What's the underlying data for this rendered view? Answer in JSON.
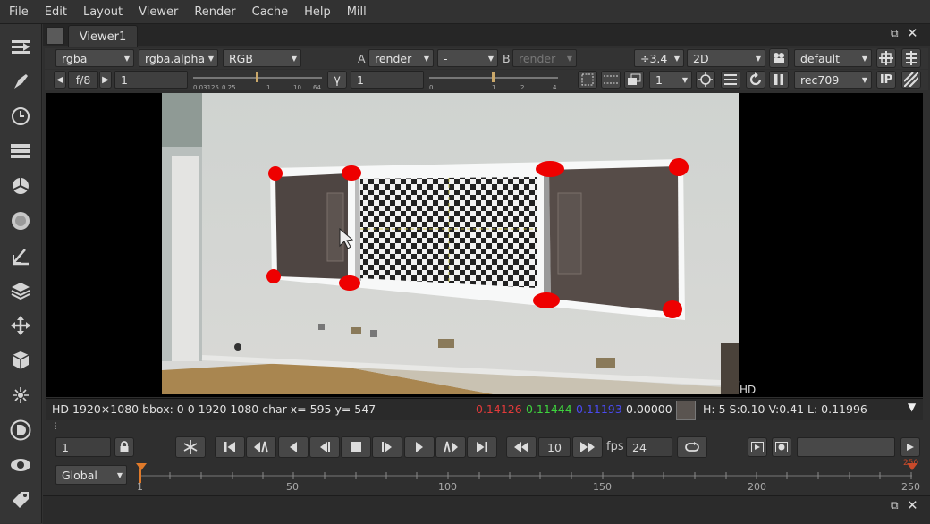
{
  "menu": [
    "File",
    "Edit",
    "Layout",
    "Viewer",
    "Render",
    "Cache",
    "Help",
    "Mill"
  ],
  "viewer_tab": "Viewer1",
  "controls": {
    "channels": "rgba",
    "alpha_channel": "rgba.alpha",
    "display_channels": "RGB",
    "a_label": "A",
    "a_input": "render",
    "a_op": "-",
    "b_label": "B",
    "b_input": "render",
    "proxy": "÷3.4",
    "view_mode": "2D",
    "lut": "default",
    "fstop": "f/8",
    "gain_value": "1",
    "gain_ticks": [
      "0.03125",
      "0.25",
      "1",
      "10",
      "64"
    ],
    "gamma_label": "γ",
    "gamma_value": "1",
    "gamma_ticks": [
      "0",
      "1",
      "2",
      "4"
    ],
    "pixel_ratio": "1",
    "colorspace": "rec709",
    "ip_label": "IP"
  },
  "format_label": "HD",
  "status": {
    "info": "HD 1920×1080 bbox: 0 0 1920 1080 char  x= 595 y= 547",
    "r": "0.14126",
    "g": "0.11444",
    "b": "0.11193",
    "a": "0.00000",
    "hsvl": "H:  5 S:0.10 V:0.41  L: 0.11996"
  },
  "colors": {
    "r": "#e03a3a",
    "g": "#3dd23d",
    "b": "#3a3ae6",
    "marker": "#ee0000",
    "swatch": "#5a5450"
  },
  "timeline": {
    "frame": "1",
    "increment": "10",
    "fps_label": "fps",
    "fps": "24",
    "scope": "Global",
    "ticks": [
      "1",
      "50",
      "100",
      "150",
      "200",
      "250"
    ],
    "end_marker": "250"
  },
  "toolbar_icons": [
    "read-icon",
    "paint-icon",
    "time-icon",
    "channel-icon",
    "color-icon",
    "filter-icon",
    "keyer-icon",
    "merge-icon",
    "transform-icon",
    "3d-icon",
    "particles-icon",
    "deep-icon",
    "views-icon",
    "other-icon"
  ]
}
